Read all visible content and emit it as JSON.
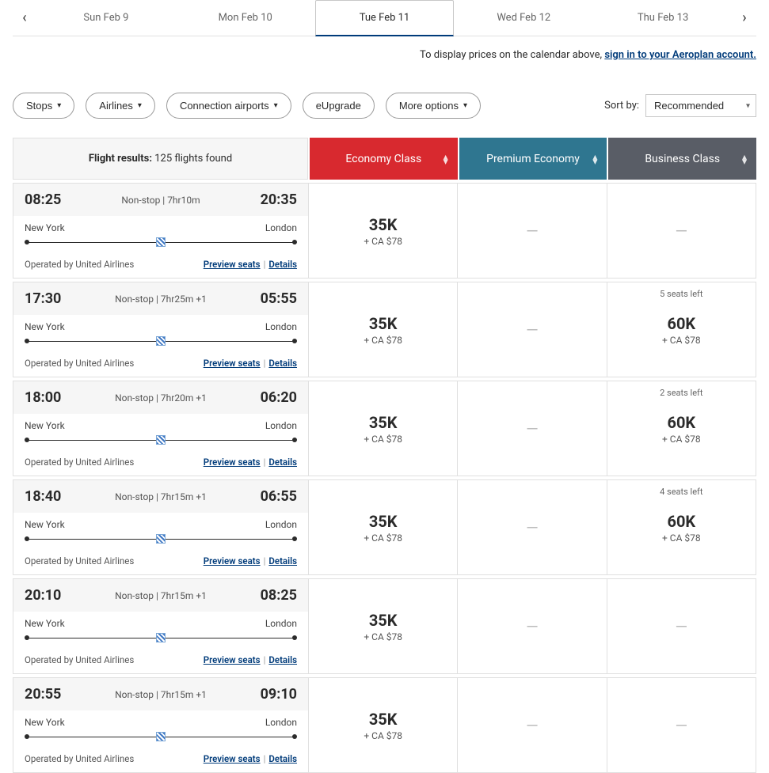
{
  "dateTabs": {
    "items": [
      "Sun Feb 9",
      "Mon Feb 10",
      "Tue Feb 11",
      "Wed Feb 12",
      "Thu Feb 13"
    ],
    "activeIndex": 2
  },
  "signinNotice": {
    "prefix": "To display prices on the calendar above, ",
    "linkText": "sign in to your Aeroplan account."
  },
  "filters": {
    "stops": "Stops",
    "airlines": "Airlines",
    "connection": "Connection airports",
    "eupgrade": "eUpgrade",
    "more": "More options"
  },
  "sort": {
    "label": "Sort by:",
    "value": "Recommended"
  },
  "resultsHeader": {
    "label": "Flight results:",
    "count": "125 flights found",
    "classes": {
      "economy": "Economy Class",
      "premium": "Premium Economy",
      "business": "Business Class"
    }
  },
  "links": {
    "preview": "Preview seats",
    "details": "Details"
  },
  "flights": [
    {
      "dep": "08:25",
      "arr": "20:35",
      "stops": "Non-stop",
      "dur": "7hr10m",
      "plus": "",
      "from": "New York",
      "to": "London",
      "operator": "Operated by United Airlines",
      "economy": {
        "pts": "35K",
        "sur": "+ CA $78"
      },
      "premium": null,
      "business": null
    },
    {
      "dep": "17:30",
      "arr": "05:55",
      "stops": "Non-stop",
      "dur": "7hr25m",
      "plus": "+1",
      "from": "New York",
      "to": "London",
      "operator": "Operated by United Airlines",
      "economy": {
        "pts": "35K",
        "sur": "+ CA $78"
      },
      "premium": null,
      "business": {
        "seats": "5 seats left",
        "pts": "60K",
        "sur": "+ CA $78"
      }
    },
    {
      "dep": "18:00",
      "arr": "06:20",
      "stops": "Non-stop",
      "dur": "7hr20m",
      "plus": "+1",
      "from": "New York",
      "to": "London",
      "operator": "Operated by United Airlines",
      "economy": {
        "pts": "35K",
        "sur": "+ CA $78"
      },
      "premium": null,
      "business": {
        "seats": "2 seats left",
        "pts": "60K",
        "sur": "+ CA $78"
      }
    },
    {
      "dep": "18:40",
      "arr": "06:55",
      "stops": "Non-stop",
      "dur": "7hr15m",
      "plus": "+1",
      "from": "New York",
      "to": "London",
      "operator": "Operated by United Airlines",
      "economy": {
        "pts": "35K",
        "sur": "+ CA $78"
      },
      "premium": null,
      "business": {
        "seats": "4 seats left",
        "pts": "60K",
        "sur": "+ CA $78"
      }
    },
    {
      "dep": "20:10",
      "arr": "08:25",
      "stops": "Non-stop",
      "dur": "7hr15m",
      "plus": "+1",
      "from": "New York",
      "to": "London",
      "operator": "Operated by United Airlines",
      "economy": {
        "pts": "35K",
        "sur": "+ CA $78"
      },
      "premium": null,
      "business": null
    },
    {
      "dep": "20:55",
      "arr": "09:10",
      "stops": "Non-stop",
      "dur": "7hr15m",
      "plus": "+1",
      "from": "New York",
      "to": "London",
      "operator": "Operated by United Airlines",
      "economy": {
        "pts": "35K",
        "sur": "+ CA $78"
      },
      "premium": null,
      "business": null
    }
  ]
}
